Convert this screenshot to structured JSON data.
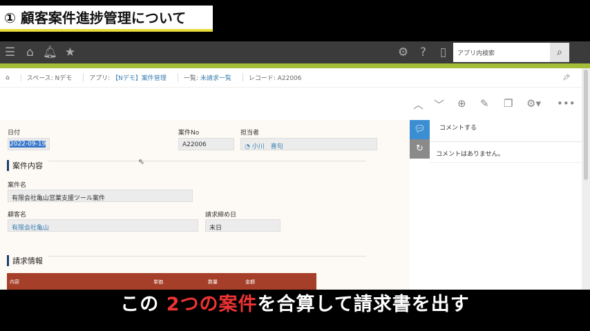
{
  "banner": {
    "title": "① 顧客案件進捗管理について"
  },
  "header": {
    "search_placeholder": "アプリ内検索"
  },
  "breadcrumb": {
    "space": "スペース: Nデモ",
    "app_prefix": "アプリ: ",
    "app": "【Nデモ】案件管理",
    "view_prefix": "一覧: ",
    "view": "未請求一覧",
    "record": "レコード: A22006"
  },
  "form": {
    "date_label": "日付",
    "date_value": "2022-09-19",
    "case_no_label": "案件No",
    "case_no_value": "A22006",
    "assignee_label": "担当者",
    "assignee_value": "小川　喜句",
    "section1": "案件内容",
    "case_name_label": "案件名",
    "case_name_value": "有限会社亀山営業支援ツール案件",
    "customer_label": "顧客名",
    "customer_value": "有限会社亀山",
    "closing_label": "請求締め日",
    "closing_value": "末日",
    "section2": "請求情報",
    "table_headers": [
      "内容",
      "単価",
      "数量",
      "金額"
    ]
  },
  "comments": {
    "post": "コメントする",
    "empty": "コメントはありません。"
  },
  "subtitle": {
    "part1": "この",
    "part2": "2つの案件",
    "part3": "を合算して請求書を出す"
  },
  "colors": {
    "accent": "#a4be3a",
    "table_header": "#a63f29",
    "section_bar": "#1d3d6b"
  }
}
